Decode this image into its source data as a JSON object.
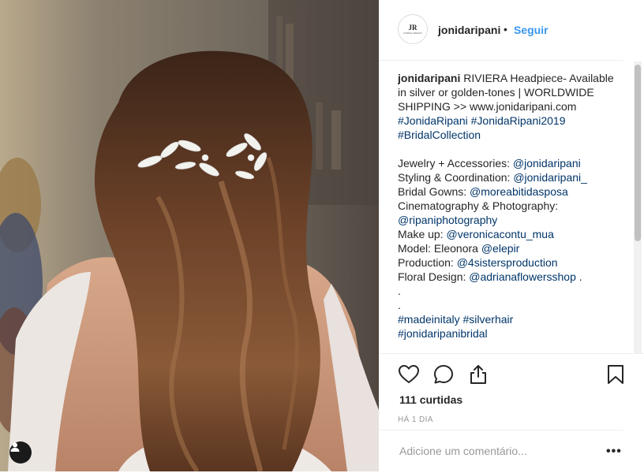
{
  "post": {
    "username": "jonidaripani",
    "dot": "•",
    "follow_label": "Seguir",
    "avatar_monogram": "JR",
    "avatar_subtext": "JONIDA RIPANI"
  },
  "caption": {
    "username": "jonidaripani",
    "line1": " RIVIERA Headpiece- Available in silver or golden-tones | WORLDWIDE SHIPPING >> www.jonidaripani.com",
    "hashtags1": [
      "#JonidaRipani",
      "#JonidaRipani2019",
      "#BridalCollection"
    ],
    "credits": [
      {
        "label": "Jewelry + Accessories: ",
        "handle": "@jonidaripani"
      },
      {
        "label": "Styling & Coordination: ",
        "handle": "@jonidaripani_"
      },
      {
        "label": "Bridal Gowns: ",
        "handle": "@moreabitidasposa"
      },
      {
        "label": "Cinematography & Photography: ",
        "handle": "@ripaniphotography"
      },
      {
        "label": "Make up: ",
        "handle": "@veronicacontu_mua"
      },
      {
        "label": "Model: Eleonora ",
        "handle": "@elepir"
      },
      {
        "label": "Production: ",
        "handle": "@4sistersproduction"
      },
      {
        "label": "Floral Design: ",
        "handle": "@adrianaflowersshop",
        "suffix": " ."
      }
    ],
    "dot1": ".",
    "dot2": ".",
    "hashtags2": [
      "#madeinitaly",
      "#silverhair",
      "#jonidaripanibridal"
    ]
  },
  "stats": {
    "likes": "111 curtidas",
    "time_ago": "HÁ 1 DIA"
  },
  "comment": {
    "placeholder": "Adicione um comentário...",
    "more_label": "•••"
  },
  "icons": {
    "like": "heart-icon",
    "comment": "comment-icon",
    "share": "share-icon",
    "save": "bookmark-icon",
    "tag": "user-tag-icon"
  },
  "colors": {
    "link": "#003569",
    "follow": "#3897f0",
    "muted": "#999999"
  }
}
